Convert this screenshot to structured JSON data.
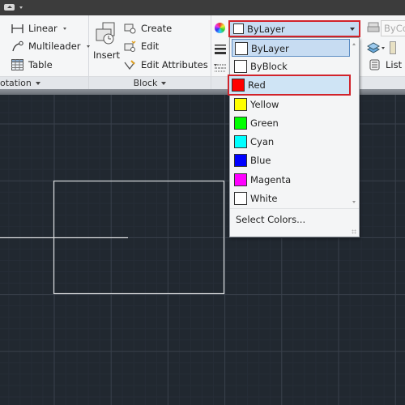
{
  "titlebar": {
    "quick_access_icon": "quick-access-toolbar-icon"
  },
  "ribbon": {
    "annotation_panel": {
      "title": "otation",
      "buttons": [
        {
          "label": "Linear",
          "icon": "linear-dimension-icon",
          "has_dropdown": true
        },
        {
          "label": "Multileader",
          "icon": "multileader-icon",
          "has_dropdown": true
        },
        {
          "label": "Table",
          "icon": "table-icon",
          "has_dropdown": false
        }
      ]
    },
    "block_panel": {
      "title": "Block",
      "insert_label": "Insert",
      "buttons": [
        {
          "label": "Create",
          "icon": "create-block-icon"
        },
        {
          "label": "Edit",
          "icon": "edit-block-icon"
        },
        {
          "label": "Edit Attributes",
          "icon": "edit-attributes-icon",
          "has_dropdown": true
        }
      ]
    },
    "properties_panel": {
      "color_combo_value": "ByLayer",
      "linetype_combo_value": "ByCo",
      "list_label": "List"
    }
  },
  "color_dropdown": {
    "items": [
      {
        "label": "ByLayer",
        "color": "#ffffff",
        "state": "selected"
      },
      {
        "label": "ByBlock",
        "color": "#ffffff",
        "state": "normal"
      },
      {
        "label": "Red",
        "color": "#ff0000",
        "state": "highlighted"
      },
      {
        "label": "Yellow",
        "color": "#ffff00",
        "state": "normal"
      },
      {
        "label": "Green",
        "color": "#00ff00",
        "state": "normal"
      },
      {
        "label": "Cyan",
        "color": "#00ffff",
        "state": "normal"
      },
      {
        "label": "Blue",
        "color": "#0000ff",
        "state": "normal"
      },
      {
        "label": "Magenta",
        "color": "#ff00ff",
        "state": "normal"
      },
      {
        "label": "White",
        "color": "#ffffff",
        "state": "normal"
      }
    ],
    "footer_label": "Select Colors..."
  },
  "colors": {
    "canvas_bg": "#212830",
    "highlight_border": "#d1232b",
    "selection_bg": "#c7dcf2"
  }
}
